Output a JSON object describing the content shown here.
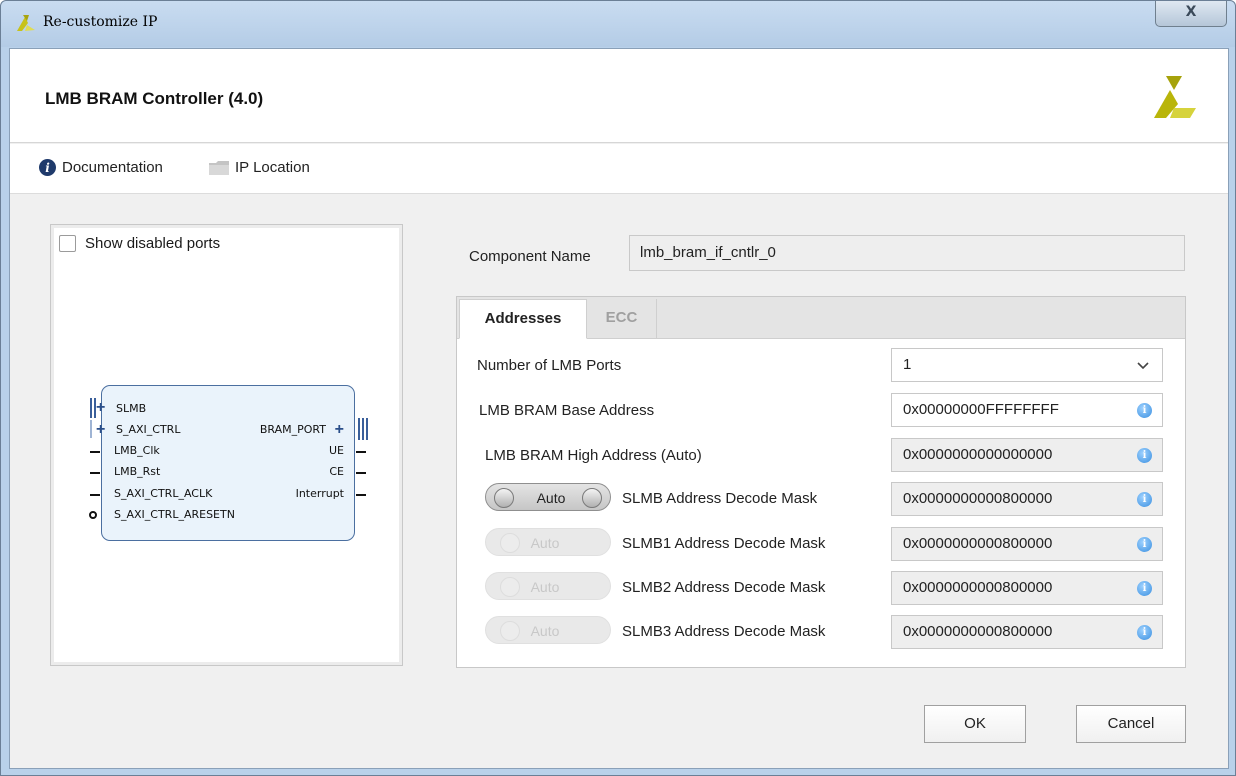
{
  "window": {
    "title": "Re-customize IP",
    "close_label": "X"
  },
  "header": {
    "ip_title": "LMB BRAM Controller (4.0)",
    "logo_icon": "xilinx-logo"
  },
  "docbar": {
    "documentation_label": "Documentation",
    "ip_location_label": "IP Location"
  },
  "symbol_panel": {
    "show_disabled_ports_label": "Show disabled ports",
    "show_disabled_ports_checked": false,
    "left_ports": [
      "SLMB",
      "S_AXI_CTRL",
      "LMB_Clk",
      "LMB_Rst",
      "S_AXI_CTRL_ACLK",
      "S_AXI_CTRL_ARESETN"
    ],
    "right_ports": [
      "BRAM_PORT",
      "UE",
      "CE",
      "Interrupt"
    ]
  },
  "component": {
    "label": "Component Name",
    "value": "lmb_bram_if_cntlr_0"
  },
  "tabs": [
    {
      "label": "Addresses",
      "active": true
    },
    {
      "label": "ECC",
      "active": false
    }
  ],
  "addresses": {
    "num_ports_label": "Number of LMB Ports",
    "num_ports_value": "1",
    "base_addr_label": "LMB BRAM Base Address",
    "base_addr_value": "0x00000000FFFFFFFF",
    "high_addr_label": "LMB BRAM High Address (Auto)",
    "high_addr_value": "0x0000000000000000",
    "masks": [
      {
        "toggle_label": "Auto",
        "enabled": true,
        "label": "SLMB Address Decode Mask",
        "value": "0x0000000000800000"
      },
      {
        "toggle_label": "Auto",
        "enabled": false,
        "label": "SLMB1 Address Decode Mask",
        "value": "0x0000000000800000"
      },
      {
        "toggle_label": "Auto",
        "enabled": false,
        "label": "SLMB2 Address Decode Mask",
        "value": "0x0000000000800000"
      },
      {
        "toggle_label": "Auto",
        "enabled": false,
        "label": "SLMB3 Address Decode Mask",
        "value": "0x0000000000800000"
      }
    ]
  },
  "buttons": {
    "ok_label": "OK",
    "cancel_label": "Cancel"
  },
  "colors": {
    "titlebar": "#b9d1ea",
    "block_fill": "#eaf3fb",
    "block_border": "#4b6fa0",
    "logo_yellow": "#b9b50a"
  }
}
